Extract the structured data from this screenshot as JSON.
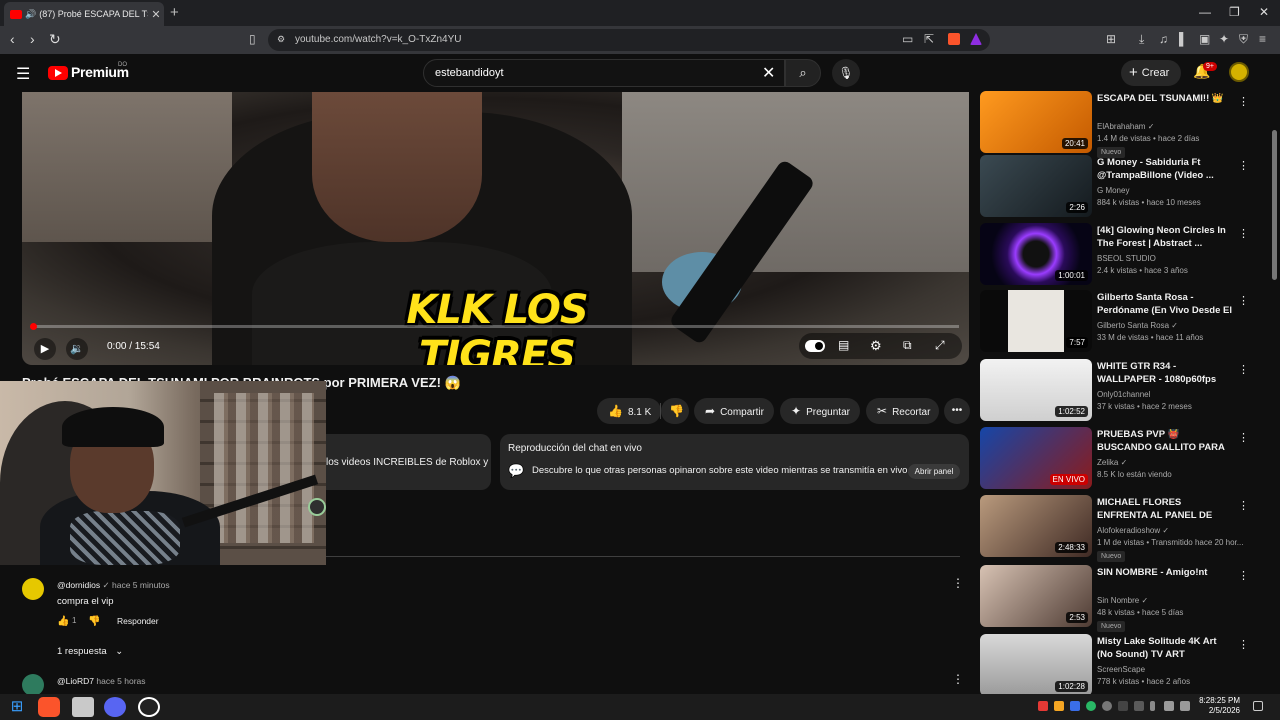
{
  "browser": {
    "tab_title": "(87) Probé ESCAPA DEL TSUN",
    "tab_audio_icon": "speaker-icon",
    "new_tab": "+",
    "url": "youtube.com/watch?v=k_O-TxZn4YU"
  },
  "masthead": {
    "logo_text": "Premium",
    "logo_suffix": "DO",
    "search_value": "estebandidoyt",
    "create_label": "Crear",
    "notif_count": "9+"
  },
  "player": {
    "caption": "KLK LOS TIGRES",
    "time": "0:00 / 15:54",
    "progress": 0.002
  },
  "video": {
    "title": "Probé ESCAPA DEL TSUNAMI POR BRAINROTS por PRIMERA VEZ! 😱",
    "likes": "8.1 K",
    "share_label": "Compartir",
    "ask_label": "Preguntar",
    "clip_label": "Recortar",
    "description_snippet": "los videos INCREIBLES de Roblox y"
  },
  "chat": {
    "heading": "Reproducción del chat en vivo",
    "description": "Descubre lo que otras personas opinaron sobre este video mientras se transmitía en vivo.",
    "open_label": "Abrir panel"
  },
  "comments": [
    {
      "user": "@dornidios",
      "check": "✓",
      "time": "hace 5 minutos",
      "text": "compra el vip",
      "likes": "1",
      "reply_label": "Responder",
      "replies_label": "1 respuesta"
    },
    {
      "user": "@LioRD7",
      "time": "hace 5 horas"
    }
  ],
  "recommendations": [
    {
      "title": "ESCAPA DEL TSUNAMI!! 👑",
      "channel": "ElAbrahaham",
      "verified": true,
      "meta": "1.4 M de vistas • hace 2 días",
      "badge": "Nuevo",
      "duration": "20:41",
      "thumb": "linear-gradient(135deg,#ff9a1f,#c45a00)"
    },
    {
      "title": "G Money - Sabiduria Ft @TrampaBillone (Video ...",
      "channel": "G Money",
      "verified": false,
      "meta": "884 k vistas • hace 10 meses",
      "badge": "",
      "duration": "2:26",
      "thumb": "linear-gradient(135deg,#3b4a52,#141a1e)"
    },
    {
      "title": "[4k] Glowing Neon Circles In The Forest | Abstract ...",
      "channel": "BSEOL STUDIO",
      "verified": false,
      "meta": "2.4 k vistas • hace 3 años",
      "badge": "",
      "duration": "1:00:01",
      "thumb": "radial-gradient(circle,#111 20%,#9a3cff 32%,#2a0b5a 45%,#060415 70%)"
    },
    {
      "title": "Gilberto Santa Rosa - Perdóname (En Vivo Desde El ...",
      "channel": "Gilberto Santa Rosa",
      "verified": true,
      "meta": "33 M de vistas • hace 11 años",
      "badge": "",
      "duration": "7:57",
      "thumb": "linear-gradient(90deg,#0a0a0a 25%,#e9e6e0 25%,#e9e6e0 75%,#0a0a0a 75%)"
    },
    {
      "title": "WHITE GTR R34 - WALLPAPER - 1080p60fps",
      "channel": "Only01channel",
      "verified": false,
      "meta": "37 k vistas • hace 2 meses",
      "badge": "",
      "duration": "1:02:52",
      "thumb": "linear-gradient(180deg,#f2f2f2,#cfcfcf)"
    },
    {
      "title": "PRUEBAS PVP 👹 BUSCANDO GALLITO PARA HACERLO ...",
      "channel": "Zelika",
      "verified": true,
      "meta": "8.5 K lo están viendo",
      "badge": "",
      "duration": "EN VIVO",
      "thumb": "linear-gradient(135deg,#1546a8,#8c1b1b)"
    },
    {
      "title": "MICHAEL FLORES ENFRENTA AL PANEL DE ALOFOKE RADIO...",
      "channel": "Alofokeradioshow",
      "verified": true,
      "meta": "1 M de vistas • Transmitido hace 20 hor...",
      "badge": "Nuevo",
      "duration": "2:48:33",
      "thumb": "linear-gradient(135deg,#b99a7d,#3f2a24)"
    },
    {
      "title": "SIN NOMBRE - Amigo!nt",
      "channel": "Sin Nombre",
      "verified": true,
      "meta": "48 k vistas • hace 5 días",
      "badge": "Nuevo",
      "duration": "2:53",
      "thumb": "linear-gradient(135deg,#d7c2b3,#4e3b33)"
    },
    {
      "title": "Misty Lake Solitude 4K Art (No Sound) TV ART SCREENSAVE...",
      "channel": "ScreenScape",
      "verified": false,
      "meta": "778 k vistas • hace 2 años",
      "badge": "",
      "duration": "1:02:28",
      "thumb": "linear-gradient(180deg,#d9d9d9,#9a9a9a)"
    }
  ],
  "taskbar": {
    "time": "8:28:25 PM",
    "date": "2/5/2026"
  }
}
